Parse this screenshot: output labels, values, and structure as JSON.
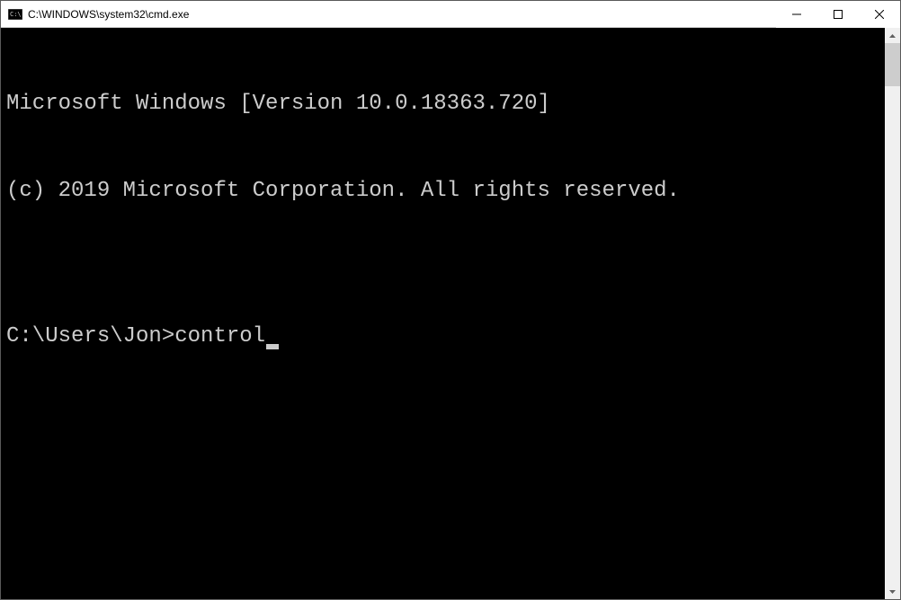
{
  "window": {
    "title": "C:\\WINDOWS\\system32\\cmd.exe"
  },
  "terminal": {
    "line1": "Microsoft Windows [Version 10.0.18363.720]",
    "line2": "(c) 2019 Microsoft Corporation. All rights reserved.",
    "blank": "",
    "prompt": "C:\\Users\\Jon>",
    "command": "control"
  }
}
